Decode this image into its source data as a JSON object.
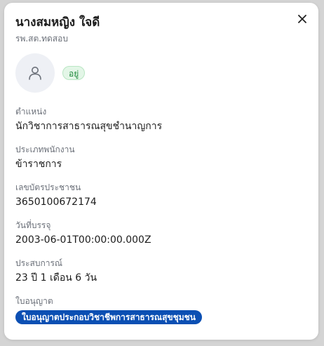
{
  "dialog": {
    "title": "นางสมหญิง ใจดี",
    "subtitle": "รพ.สต.ทดสอบ",
    "close_icon": "close-icon",
    "avatar_icon": "person-icon",
    "status_badge": "อยู่",
    "status_color": "#1f8a3b"
  },
  "fields": {
    "position": {
      "label": "ตำแหน่ง",
      "value": "นักวิชาการสาธารณสุขชำนาญการ"
    },
    "employee_type": {
      "label": "ประเภทพนักงาน",
      "value": "ข้าราชการ"
    },
    "citizen_id": {
      "label": "เลขบัตรประชาชน",
      "value": "3650100672174"
    },
    "start_date": {
      "label": "วันที่บรรจุ",
      "value": "2003-06-01T00:00:00.000Z"
    },
    "experience": {
      "label": "ประสบการณ์",
      "value": "23 ปี 1 เดือน 6 วัน"
    },
    "license": {
      "label": "ใบอนุญาต",
      "chips": [
        "ใบอนุญาตประกอบวิชาชีพการสาธารณสุขชุมชน"
      ],
      "chip_color": "#0b4fb3"
    }
  }
}
